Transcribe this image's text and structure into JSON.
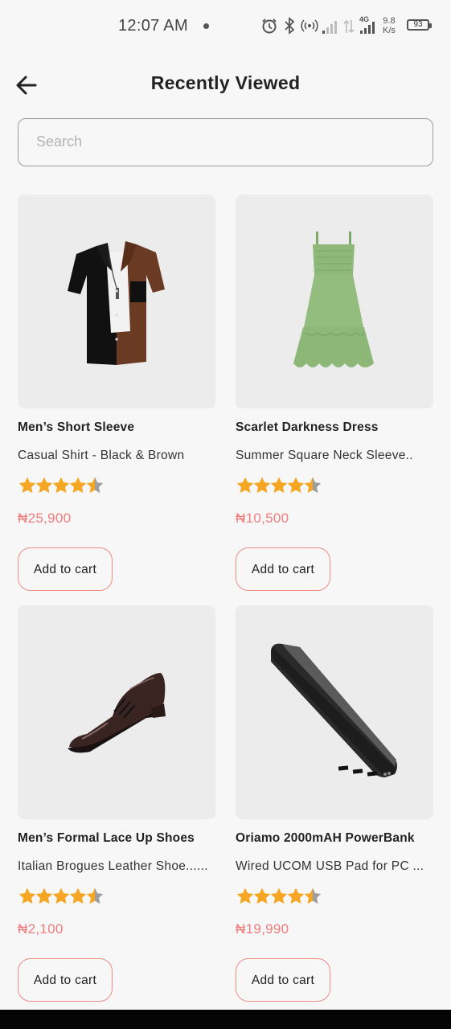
{
  "status_bar": {
    "time": "12:07 AM",
    "network_speed_value": "9.8",
    "network_speed_unit": "K/s",
    "network_type": "4G",
    "battery_level": "93"
  },
  "header": {
    "title": "Recently Viewed",
    "back_icon": "arrow-left-icon"
  },
  "search": {
    "placeholder": "Search",
    "value": ""
  },
  "colors": {
    "price": "#f07c7c",
    "button_border": "#f08c84",
    "star": "#f5a623",
    "star_empty": "#9e9e9e"
  },
  "products": [
    {
      "name": "Men’s Short Sleeve",
      "subtitle": "Casual Shirt - Black & Brown",
      "rating": 4.5,
      "price": "₦25,900",
      "button_label": "Add to cart",
      "image_icon": "shirt-image"
    },
    {
      "name": "Scarlet Darkness Dress",
      "subtitle": "Summer Square Neck Sleeve..",
      "rating": 4.5,
      "price": "₦10,500",
      "button_label": "Add to cart",
      "image_icon": "dress-image"
    },
    {
      "name": "Men’s Formal Lace Up Shoes",
      "subtitle": "Italian Brogues Leather Shoe......",
      "rating": 4.5,
      "price": "₦2,100",
      "button_label": "Add to cart",
      "image_icon": "shoe-image"
    },
    {
      "name": "Oriamo 2000mAH PowerBank",
      "subtitle": "Wired UCOM USB Pad for PC ...",
      "rating": 4.5,
      "price": "₦19,990",
      "button_label": "Add to cart",
      "image_icon": "powerbank-image"
    }
  ]
}
